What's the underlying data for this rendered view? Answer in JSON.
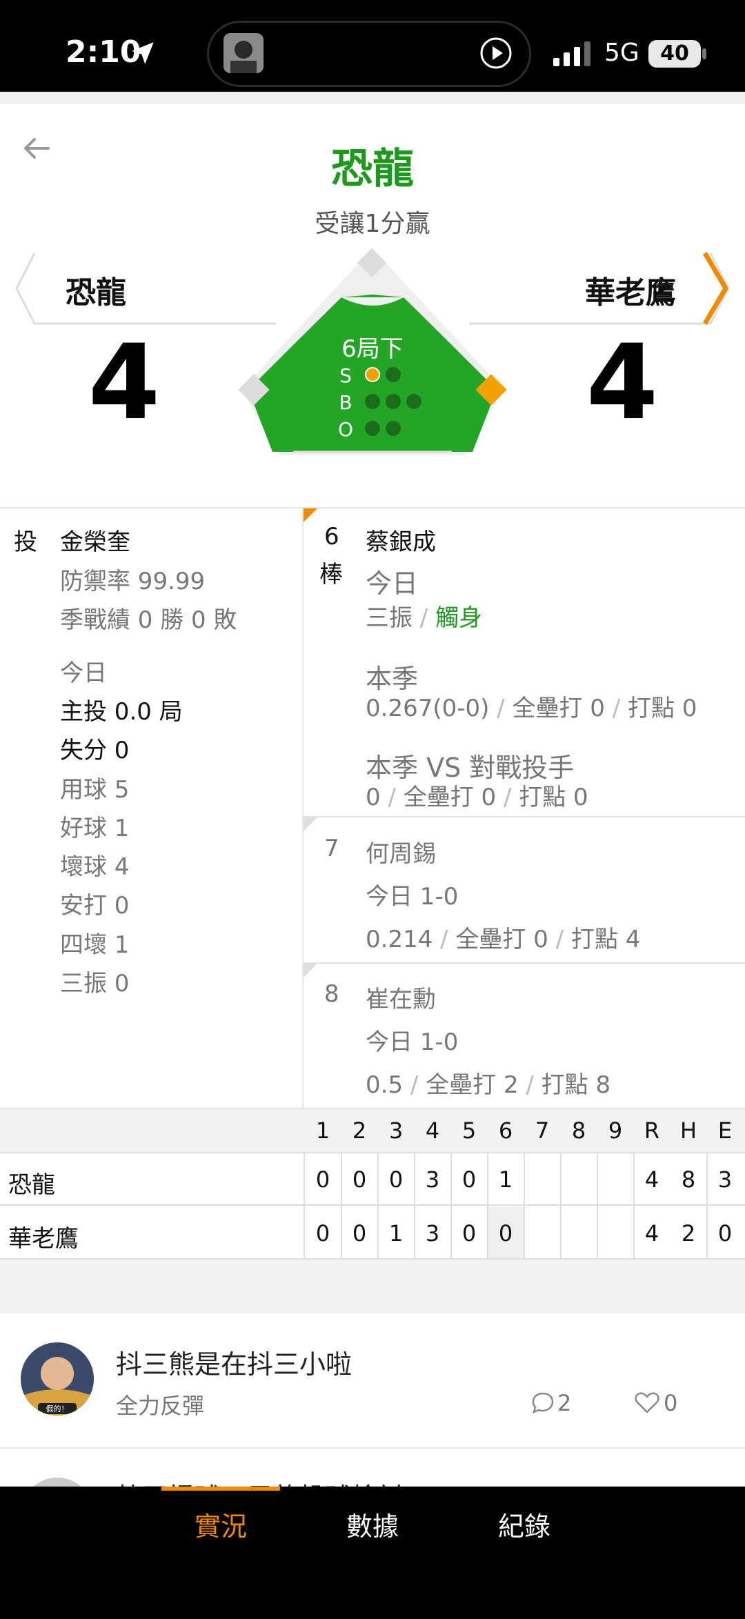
{
  "status_bar": {
    "time": "2:10",
    "network": "5G",
    "battery": "40"
  },
  "header": {
    "title": "恐龍",
    "subtitle": "受讓1分贏"
  },
  "game": {
    "away_team": "恐龍",
    "home_team": "華老鷹",
    "away_score": "4",
    "home_score": "4",
    "inning": "6局下",
    "count_labels": [
      "S",
      "B",
      "O"
    ],
    "strikes": 1,
    "balls": 0,
    "outs": 0
  },
  "pitcher": {
    "role": "投",
    "name": "金榮奎",
    "era_label": "防禦率 99.99",
    "season_label": "季戰績 0 勝 0 敗",
    "today_label": "今日",
    "stats": [
      {
        "label": "主投 0.0 局",
        "emph": true
      },
      {
        "label": "失分 0",
        "emph": true
      },
      {
        "label": "用球 5",
        "emph": false
      },
      {
        "label": "好球 1",
        "emph": false
      },
      {
        "label": "壞球 4",
        "emph": false
      },
      {
        "label": "安打 0",
        "emph": false
      },
      {
        "label": "四壞 1",
        "emph": false
      },
      {
        "label": "三振 0",
        "emph": false
      }
    ]
  },
  "batters": [
    {
      "order": "6",
      "order_suffix": "棒",
      "name": "蔡銀成",
      "today_label": "今日",
      "today_results": [
        "三振",
        "觸身"
      ],
      "season_label": "本季",
      "season_stats": [
        "0.267(0-0)",
        "全壘打 0",
        "打點 0"
      ],
      "vs_label": "本季 VS 對戰投手",
      "vs_stats": [
        "0",
        "全壘打 0",
        "打點 0"
      ]
    },
    {
      "order": "7",
      "name": "何周錫",
      "today_label": "今日 1-0",
      "season_stats": [
        "0.214",
        "全壘打 0",
        "打點 4"
      ]
    },
    {
      "order": "8",
      "name": "崔在勳",
      "today_label": "今日 1-0",
      "season_stats": [
        "0.5",
        "全壘打 2",
        "打點 8"
      ]
    }
  ],
  "linescore": {
    "headers": [
      "1",
      "2",
      "3",
      "4",
      "5",
      "6",
      "7",
      "8",
      "9",
      "R",
      "H",
      "E"
    ],
    "rows": [
      {
        "team": "恐龍",
        "cells": [
          "0",
          "0",
          "0",
          "3",
          "0",
          "1",
          "",
          "",
          "",
          "4",
          "8",
          "3"
        ]
      },
      {
        "team": "華老鷹",
        "cells": [
          "0",
          "0",
          "1",
          "3",
          "0",
          "0",
          "",
          "",
          "",
          "4",
          "2",
          "0"
        ]
      }
    ]
  },
  "comments": [
    {
      "title": "抖三熊是在抖三小啦",
      "user": "全力反彈",
      "comment_count": "2",
      "like_count": "0",
      "avatar_caption": "假的！"
    },
    {
      "title": "韓天慢球一局的投球檢討"
    }
  ],
  "tabs": [
    {
      "label": "實況",
      "active": true
    },
    {
      "label": "數據",
      "active": false
    },
    {
      "label": "紀錄",
      "active": false
    }
  ],
  "colors": {
    "accent": "#f08a00",
    "field": "#25a525",
    "title_green": "#1d9a1d"
  }
}
